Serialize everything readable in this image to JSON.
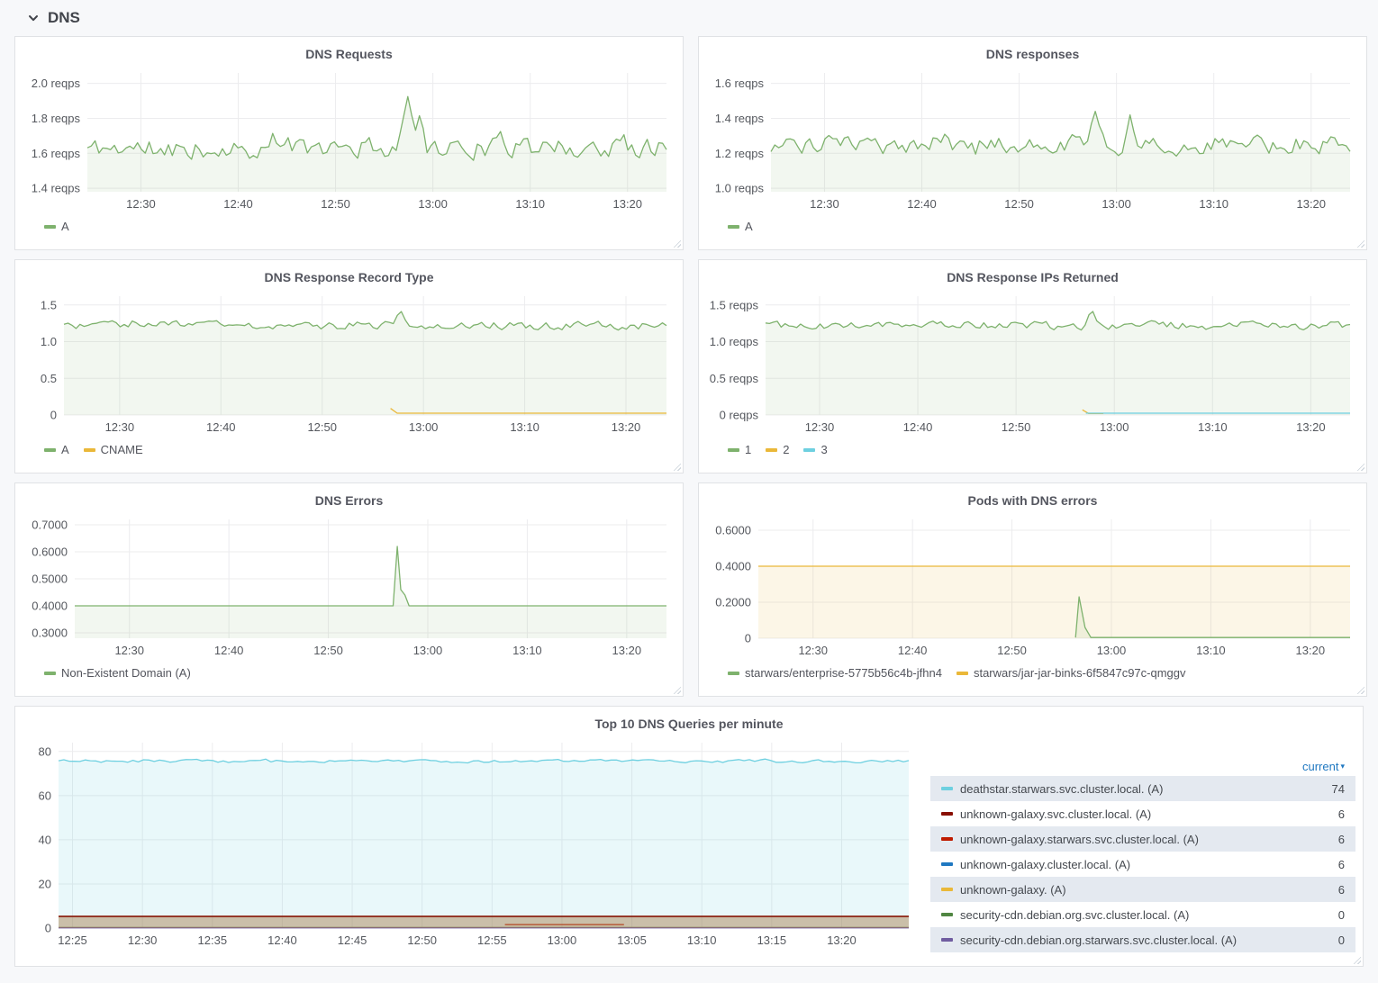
{
  "section": {
    "title": "DNS"
  },
  "ui": {
    "sort_icon": "▾"
  },
  "colors": {
    "green": "#7eb26d",
    "yellow": "#eab839",
    "cyan": "#6ed0e0",
    "darkred": "#890f02",
    "red": "#bf1b00",
    "blue": "#1f78c1",
    "darkgreen": "#508642",
    "purple": "#705da0",
    "accent_blue": "#1f78c1",
    "row_highlight": "#e4e9f0"
  },
  "chart_data": [
    {
      "id": "dns-requests",
      "type": "line",
      "title": "DNS Requests",
      "ylim": [
        1.38,
        2.06
      ],
      "mleft": 72,
      "yticks": [
        {
          "v": 2.0,
          "label": "2.0 reqps"
        },
        {
          "v": 1.8,
          "label": "1.8 reqps"
        },
        {
          "v": 1.6,
          "label": "1.6 reqps"
        },
        {
          "v": 1.4,
          "label": "1.4 reqps"
        }
      ],
      "x": {
        "min": 744.5,
        "max": 804,
        "ticks": [
          {
            "m": 750,
            "label": "12:30"
          },
          {
            "m": 760,
            "label": "12:40"
          },
          {
            "m": 770,
            "label": "12:50"
          },
          {
            "m": 780,
            "label": "13:00"
          },
          {
            "m": 790,
            "label": "13:10"
          },
          {
            "m": 800,
            "label": "13:20"
          }
        ]
      },
      "series": [
        {
          "name": "A",
          "color": "green",
          "fill": true,
          "gen": {
            "seed": 11,
            "base": 1.63,
            "amp": 0.085,
            "n": 150,
            "clampMin": 1.45,
            "clampMax": 1.95,
            "spikes": [
              {
                "t": 0.553,
                "v": 1.93,
                "w": 0.018
              },
              {
                "t": 0.575,
                "v": 1.85,
                "w": 0.013
              }
            ]
          }
        }
      ]
    },
    {
      "id": "dns-responses",
      "type": "line",
      "title": "DNS responses",
      "ylim": [
        0.98,
        1.66
      ],
      "mleft": 72,
      "yticks": [
        {
          "v": 1.6,
          "label": "1.6 reqps"
        },
        {
          "v": 1.4,
          "label": "1.4 reqps"
        },
        {
          "v": 1.2,
          "label": "1.2 reqps"
        },
        {
          "v": 1.0,
          "label": "1.0 reqps"
        }
      ],
      "x": {
        "min": 744.5,
        "max": 804,
        "ticks": [
          {
            "m": 750,
            "label": "12:30"
          },
          {
            "m": 760,
            "label": "12:40"
          },
          {
            "m": 770,
            "label": "12:50"
          },
          {
            "m": 780,
            "label": "13:00"
          },
          {
            "m": 790,
            "label": "13:10"
          },
          {
            "m": 800,
            "label": "13:20"
          }
        ]
      },
      "series": [
        {
          "name": "A",
          "color": "green",
          "fill": true,
          "gen": {
            "seed": 23,
            "base": 1.25,
            "amp": 0.08,
            "n": 150,
            "clampMin": 1.05,
            "clampMax": 1.46,
            "spikes": [
              {
                "t": 0.56,
                "v": 1.44,
                "w": 0.014
              },
              {
                "t": 0.62,
                "v": 1.42,
                "w": 0.012
              }
            ]
          }
        }
      ]
    },
    {
      "id": "record-type",
      "type": "line",
      "title": "DNS Response Record Type",
      "ylim": [
        0,
        1.62
      ],
      "mleft": 46,
      "yticks": [
        {
          "v": 1.5,
          "label": "1.5"
        },
        {
          "v": 1.0,
          "label": "1.0"
        },
        {
          "v": 0.5,
          "label": "0.5"
        },
        {
          "v": 0,
          "label": "0"
        }
      ],
      "x": {
        "min": 744.5,
        "max": 804,
        "ticks": [
          {
            "m": 750,
            "label": "12:30"
          },
          {
            "m": 760,
            "label": "12:40"
          },
          {
            "m": 770,
            "label": "12:50"
          },
          {
            "m": 780,
            "label": "13:00"
          },
          {
            "m": 790,
            "label": "13:10"
          },
          {
            "m": 800,
            "label": "13:20"
          }
        ]
      },
      "series": [
        {
          "name": "A",
          "color": "green",
          "fill": true,
          "gen": {
            "seed": 31,
            "base": 1.22,
            "amp": 0.08,
            "n": 150,
            "clampMin": 0.95,
            "clampMax": 1.47,
            "spikes": [
              {
                "t": 0.558,
                "v": 1.45,
                "w": 0.014
              }
            ]
          }
        },
        {
          "name": "CNAME",
          "color": "yellow",
          "fill": false,
          "points": [
            [
              0.542,
              0.09
            ],
            [
              0.553,
              0.025
            ],
            [
              1,
              0.025
            ]
          ]
        }
      ]
    },
    {
      "id": "ips-returned",
      "type": "line",
      "title": "DNS Response IPs Returned",
      "ylim": [
        0,
        1.62
      ],
      "mleft": 66,
      "yticks": [
        {
          "v": 1.5,
          "label": "1.5 reqps"
        },
        {
          "v": 1.0,
          "label": "1.0 reqps"
        },
        {
          "v": 0.5,
          "label": "0.5 reqps"
        },
        {
          "v": 0,
          "label": "0 reqps"
        }
      ],
      "x": {
        "min": 744.5,
        "max": 804,
        "ticks": [
          {
            "m": 750,
            "label": "12:30"
          },
          {
            "m": 760,
            "label": "12:40"
          },
          {
            "m": 770,
            "label": "12:50"
          },
          {
            "m": 780,
            "label": "13:00"
          },
          {
            "m": 790,
            "label": "13:10"
          },
          {
            "m": 800,
            "label": "13:20"
          }
        ]
      },
      "series": [
        {
          "name": "1",
          "color": "green",
          "fill": true,
          "gen": {
            "seed": 41,
            "base": 1.22,
            "amp": 0.08,
            "n": 150,
            "clampMin": 0.97,
            "clampMax": 1.47,
            "spikes": [
              {
                "t": 0.558,
                "v": 1.45,
                "w": 0.014
              }
            ]
          }
        },
        {
          "name": "2",
          "color": "yellow",
          "fill": false,
          "points": [
            [
              0.542,
              0.07
            ],
            [
              0.553,
              0.02
            ],
            [
              0.578,
              0.02
            ]
          ]
        },
        {
          "name": "3",
          "color": "cyan",
          "fill": false,
          "points": [
            [
              0.548,
              0.025
            ],
            [
              1,
              0.025
            ]
          ]
        }
      ]
    },
    {
      "id": "dns-errors",
      "type": "line",
      "title": "DNS Errors",
      "ylim": [
        0.28,
        0.72
      ],
      "mleft": 58,
      "yticks": [
        {
          "v": 0.7,
          "label": "0.7000"
        },
        {
          "v": 0.6,
          "label": "0.6000"
        },
        {
          "v": 0.5,
          "label": "0.5000"
        },
        {
          "v": 0.4,
          "label": "0.4000"
        },
        {
          "v": 0.3,
          "label": "0.3000"
        }
      ],
      "x": {
        "min": 744.5,
        "max": 804,
        "ticks": [
          {
            "m": 750,
            "label": "12:30"
          },
          {
            "m": 760,
            "label": "12:40"
          },
          {
            "m": 770,
            "label": "12:50"
          },
          {
            "m": 780,
            "label": "13:00"
          },
          {
            "m": 790,
            "label": "13:10"
          },
          {
            "m": 800,
            "label": "13:20"
          }
        ]
      },
      "series": [
        {
          "name": "Non-Existent Domain (A)",
          "color": "green",
          "fill": true,
          "points": [
            [
              0,
              0.4
            ],
            [
              0.53,
              0.4
            ],
            [
              0.538,
              0.4
            ],
            [
              0.545,
              0.62
            ],
            [
              0.551,
              0.46
            ],
            [
              0.558,
              0.44
            ],
            [
              0.565,
              0.4
            ],
            [
              1,
              0.4
            ]
          ]
        }
      ]
    },
    {
      "id": "pods-errors",
      "type": "line",
      "title": "Pods with DNS errors",
      "ylim": [
        0,
        0.66
      ],
      "mleft": 58,
      "yticks": [
        {
          "v": 0.6,
          "label": "0.6000"
        },
        {
          "v": 0.4,
          "label": "0.4000"
        },
        {
          "v": 0.2,
          "label": "0.2000"
        },
        {
          "v": 0,
          "label": "0"
        }
      ],
      "x": {
        "min": 744.5,
        "max": 804,
        "ticks": [
          {
            "m": 750,
            "label": "12:30"
          },
          {
            "m": 760,
            "label": "12:40"
          },
          {
            "m": 770,
            "label": "12:50"
          },
          {
            "m": 780,
            "label": "13:00"
          },
          {
            "m": 790,
            "label": "13:10"
          },
          {
            "m": 800,
            "label": "13:20"
          }
        ]
      },
      "series": [
        {
          "name": "starwars/jar-jar-binks-6f5847c97c-qmggv",
          "color": "yellow",
          "fill": true,
          "fillColor": "rgba(234,184,57,0.12)",
          "points": [
            [
              0,
              0.4
            ],
            [
              1,
              0.4
            ]
          ]
        },
        {
          "name": "starwars/enterprise-5775b56c4b-jfhn4",
          "color": "green",
          "fill": true,
          "points": [
            [
              0.536,
              0.004
            ],
            [
              0.542,
              0.23
            ],
            [
              0.552,
              0.06
            ],
            [
              0.562,
              0.004
            ],
            [
              1,
              0.004
            ]
          ]
        }
      ]
    },
    {
      "id": "top10",
      "type": "line",
      "title": "Top 10 DNS Queries per minute",
      "ylim": [
        0,
        84
      ],
      "mleft": 40,
      "legend": "table",
      "yticks": [
        {
          "v": 80,
          "label": "80"
        },
        {
          "v": 60,
          "label": "60"
        },
        {
          "v": 40,
          "label": "40"
        },
        {
          "v": 20,
          "label": "20"
        },
        {
          "v": 0,
          "label": "0"
        }
      ],
      "x": {
        "min": 744,
        "max": 804.8,
        "ticks": [
          {
            "m": 745,
            "label": "12:25"
          },
          {
            "m": 750,
            "label": "12:30"
          },
          {
            "m": 755,
            "label": "12:35"
          },
          {
            "m": 760,
            "label": "12:40"
          },
          {
            "m": 765,
            "label": "12:45"
          },
          {
            "m": 770,
            "label": "12:50"
          },
          {
            "m": 775,
            "label": "12:55"
          },
          {
            "m": 780,
            "label": "13:00"
          },
          {
            "m": 785,
            "label": "13:05"
          },
          {
            "m": 790,
            "label": "13:10"
          },
          {
            "m": 795,
            "label": "13:15"
          },
          {
            "m": 800,
            "label": "13:20"
          }
        ]
      },
      "series": [
        {
          "name": "deathstar.starwars.svc.cluster.local. (A)",
          "color": "cyan",
          "fill": true,
          "fillColor": "rgba(110,208,224,0.15)",
          "gen": {
            "seed": 91,
            "base": 75.6,
            "amp": 1.0,
            "n": 160,
            "clampMin": 73.5,
            "clampMax": 77.5
          }
        },
        {
          "name": "unknown-galaxy.cluster.local. (A)",
          "color": "blue",
          "points": [
            [
              0,
              5.3
            ],
            [
              1,
              5.3
            ]
          ]
        },
        {
          "name": "unknown-galaxy. (A)",
          "color": "yellow",
          "points": [
            [
              0,
              5.3
            ],
            [
              1,
              5.3
            ]
          ]
        },
        {
          "name": "security-cdn.debian.org.svc.cluster.local. (A)",
          "color": "darkgreen",
          "points": [
            [
              0,
              0.25
            ],
            [
              1,
              0.25
            ]
          ]
        },
        {
          "name": "security-cdn.debian.org.starwars.svc.cluster.local. (A)",
          "color": "purple",
          "points": [
            [
              0,
              0.12
            ],
            [
              1,
              0.12
            ]
          ]
        },
        {
          "name": "unknown-galaxy.starwars.svc.cluster.local. (A)",
          "color": "red",
          "points": [
            [
              0.525,
              1.6
            ],
            [
              0.665,
              1.6
            ]
          ]
        },
        {
          "name": "unknown-galaxy.svc.cluster.local. (A)",
          "color": "darkred",
          "fill": true,
          "fillColor": "rgba(164,122,72,0.45)",
          "width": 1.6,
          "points": [
            [
              0,
              5.3
            ],
            [
              1,
              5.3
            ]
          ]
        }
      ]
    }
  ],
  "top10_legend": {
    "header": "current",
    "rows": [
      {
        "name": "deathstar.starwars.svc.cluster.local. (A)",
        "value": "74",
        "color": "cyan",
        "highlight": true
      },
      {
        "name": "unknown-galaxy.svc.cluster.local. (A)",
        "value": "6",
        "color": "darkred",
        "highlight": false
      },
      {
        "name": "unknown-galaxy.starwars.svc.cluster.local. (A)",
        "value": "6",
        "color": "red",
        "highlight": true
      },
      {
        "name": "unknown-galaxy.cluster.local. (A)",
        "value": "6",
        "color": "blue",
        "highlight": false
      },
      {
        "name": "unknown-galaxy. (A)",
        "value": "6",
        "color": "yellow",
        "highlight": true
      },
      {
        "name": "security-cdn.debian.org.svc.cluster.local. (A)",
        "value": "0",
        "color": "darkgreen",
        "highlight": false
      },
      {
        "name": "security-cdn.debian.org.starwars.svc.cluster.local. (A)",
        "value": "0",
        "color": "purple",
        "highlight": true
      }
    ]
  }
}
